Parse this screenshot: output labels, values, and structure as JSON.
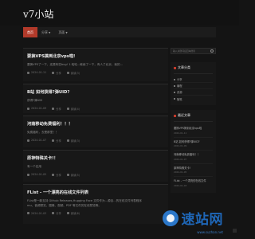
{
  "site": {
    "title": "v7小站"
  },
  "nav": {
    "items": [
      {
        "label": "首页",
        "active": true
      },
      {
        "label": "分享",
        "has_dropdown": true
      },
      {
        "label": "页面",
        "has_dropdown": true
      }
    ]
  },
  "posts": [
    {
      "title": "要换VPS搞到北京vps啦!",
      "excerpt": "要换VPS了一下，还是有些bug! 1.哈哈...继续了一下，有人了北京，我的...",
      "date": "2024-01-11",
      "category": "分享",
      "views": "阅读(3)"
    },
    {
      "title": "B站 如何获得?弹UID?",
      "excerpt": "获得?弹UID",
      "date": "2024-01-09",
      "category": "分享",
      "views": "阅读(4)"
    },
    {
      "title": "河南移动免费福利！！！",
      "excerpt": "免费福利，去是那里！！",
      "date": "2024-01-07",
      "category": "分享",
      "views": "阅读(3)"
    },
    {
      "title": "原神特殊关卡!！",
      "excerpt": "有一个应用 ",
      "date": "2024-01-05",
      "category": "分享",
      "views": "阅读(5)"
    },
    {
      "title": "FList - 一个漂亮的在线文件列表",
      "excerpt": "FList是一款支持 Github Releases,Hugging Face 文件作为...源自...的在线文件列表程序",
      "excerpt2": "mu、音频预览、图像、视频、PDF 等文件的在线预览等。",
      "date": "2024-01-03",
      "category": "分享",
      "views": "阅读(6)"
    }
  ],
  "sidebar": {
    "search_placeholder": "输入关键词后回车搜索",
    "categories_title": "文章分类",
    "categories": [
      "分享",
      "编程",
      "资源",
      "随笔"
    ],
    "recent_title": "最近文章",
    "recent": [
      {
        "title": "要换VPS搞到北京vps啦",
        "date": "2024-01-11"
      },
      {
        "title": "B站 如何获得?弹UID?",
        "date": "2024-01-09"
      },
      {
        "title": "河南移动免费福利！！",
        "date": "2024-01-07"
      },
      {
        "title": "原神特殊关卡!",
        "date": "2024-01-05"
      },
      {
        "title": "FList - 一个漂亮的在线文件",
        "date": "2024-01-03"
      }
    ]
  },
  "watermark": {
    "text": "速站网",
    "sub": "www.suzhan.net"
  },
  "colors": {
    "accent": "#b23a2a",
    "background": "#141414",
    "watermark": "#1f67b8"
  }
}
